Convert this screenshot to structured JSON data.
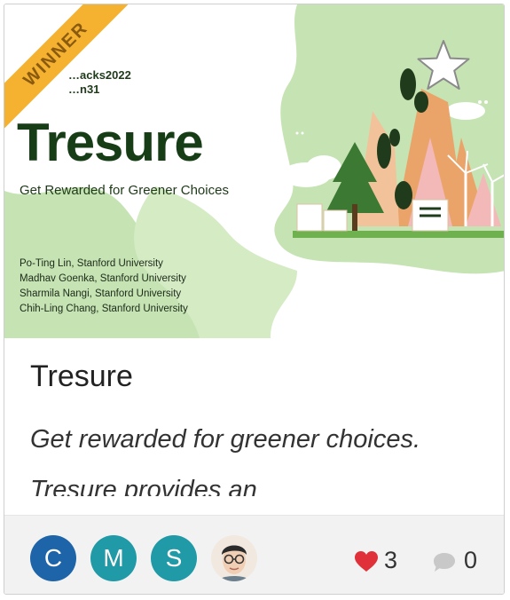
{
  "thumbnail": {
    "hackathon_line1": "…acks2022",
    "hackathon_line2": "…n31",
    "slide_title": "Tresure",
    "slide_subtitle": "Get Rewarded for Greener Choices",
    "authors": [
      "Po-Ting Lin, Stanford University",
      "Madhav Goenka, Stanford University",
      "Sharmila Nangi, Stanford University",
      "Chih-Ling Chang, Stanford University"
    ],
    "badge": "WINNER",
    "star_icon": "star-outline-icon",
    "colors": {
      "blob": "#c6e3b3",
      "ribbon": "#f5b230",
      "title": "#163d16"
    }
  },
  "project": {
    "title": "Tresure",
    "description": "Get rewarded for greener choices. Tresure provides an"
  },
  "team": [
    {
      "initial": "C",
      "color": "#1e64a8"
    },
    {
      "initial": "M",
      "color": "#1f9aa6"
    },
    {
      "initial": "S",
      "color": "#1f9aa6"
    },
    {
      "photo": true
    }
  ],
  "stats": {
    "likes": "3",
    "comments": "0",
    "like_icon": "heart-icon",
    "comment_icon": "comment-bubble-icon",
    "like_color": "#e0303a"
  }
}
